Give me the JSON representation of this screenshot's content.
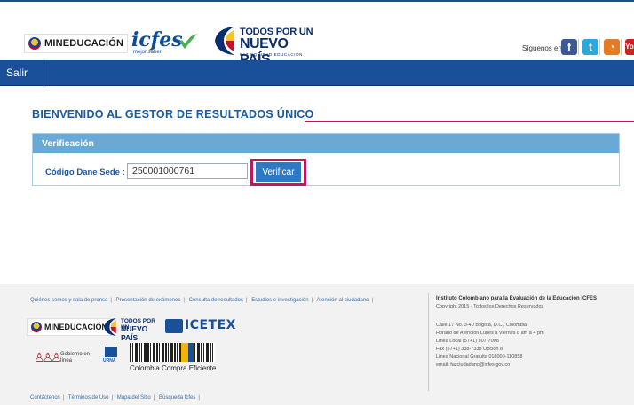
{
  "header": {
    "mineducacion": "MINEDUCACIÓN",
    "icfes": "icfes",
    "icfes_tagline": "mejor saber",
    "tpu_line1": "TODOS POR UN",
    "tpu_line2": "NUEVO PAÍS",
    "tpu_line3": "PAZ EQUIDAD EDUCACIÓN",
    "social_label": "Síguenos en:",
    "social": [
      {
        "name": "facebook",
        "glyph": "f"
      },
      {
        "name": "twitter",
        "glyph": "t"
      },
      {
        "name": "rss",
        "glyph": "◔"
      },
      {
        "name": "youtube",
        "glyph": "Yo"
      }
    ]
  },
  "nav": {
    "salir": "Salir"
  },
  "main": {
    "title": "BIENVENIDO AL GESTOR DE RESULTADOS ÚNICO",
    "panel_title": "Verificación",
    "field_label": "Código Dane Sede :",
    "required_mark": "*",
    "field_value": "250001000761",
    "verify_button": "Verificar"
  },
  "footer": {
    "links": [
      "Quiénes somos y sala de prensa",
      "Presentación de exámenes",
      "Consulta de resultados",
      "Estudios e investigación",
      "Atención al ciudadano"
    ],
    "org_name": "Instituto Colombiano para la Evaluación de la Educación ICFES",
    "copyright": "Copyright 2015 - Todos los Derechos Reservados",
    "address_lines": [
      "Calle 17 No. 3-40 Bogotá, D.C., Colombia",
      "Horario de Atención Lunes a Viernes 8 am a 4 pm",
      "Línea Local (57+1) 307-7008",
      "Fax (57+1) 338-7338 Opción 8",
      "Línea Nacional Gratuita 018000-110858",
      "email: fazciudadano@icfes.gov.co"
    ],
    "logo_mineducacion": "MINEDUCACIÓN",
    "logo_tpu_line1": "TODOS POR UN",
    "logo_tpu_line2": "NUEVO PAÍS",
    "logo_icetex": "ICETEX",
    "logo_gel": "Gobierno en línea",
    "logo_urna": "URNA",
    "logo_ccomp": "Colombia Compra Eficiente",
    "bottom_links": [
      "Contáctenos",
      "Términos de Uso",
      "Mapa del Sitio",
      "Búsqueda Icfes"
    ]
  },
  "colors": {
    "nav_blue": "#1a4f99",
    "panel_head": "#6aa8d6",
    "highlight": "#c2185b",
    "title_blue": "#1a5aa0"
  }
}
